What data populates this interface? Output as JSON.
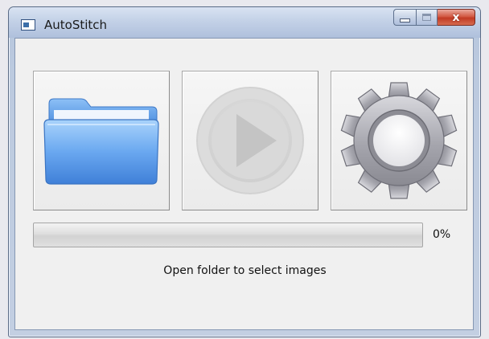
{
  "window": {
    "title": "AutoStitch",
    "controls": {
      "minimize_icon": "minimize-icon",
      "maximize_icon": "maximize-icon",
      "close_icon": "close-icon",
      "close_glyph": "x"
    }
  },
  "toolbar": {
    "buttons": [
      {
        "id": "open",
        "icon": "folder-icon",
        "enabled": true
      },
      {
        "id": "run",
        "icon": "play-icon",
        "enabled": false
      },
      {
        "id": "settings",
        "icon": "gear-icon",
        "enabled": true
      }
    ]
  },
  "progress": {
    "value": 0,
    "label": "0%"
  },
  "status": {
    "text": "Open folder to select images"
  },
  "colors": {
    "folder": "#5b9be8",
    "play_disabled": "#cfcfcf",
    "gear": "#8f8f96",
    "close_button": "#c9442c"
  }
}
